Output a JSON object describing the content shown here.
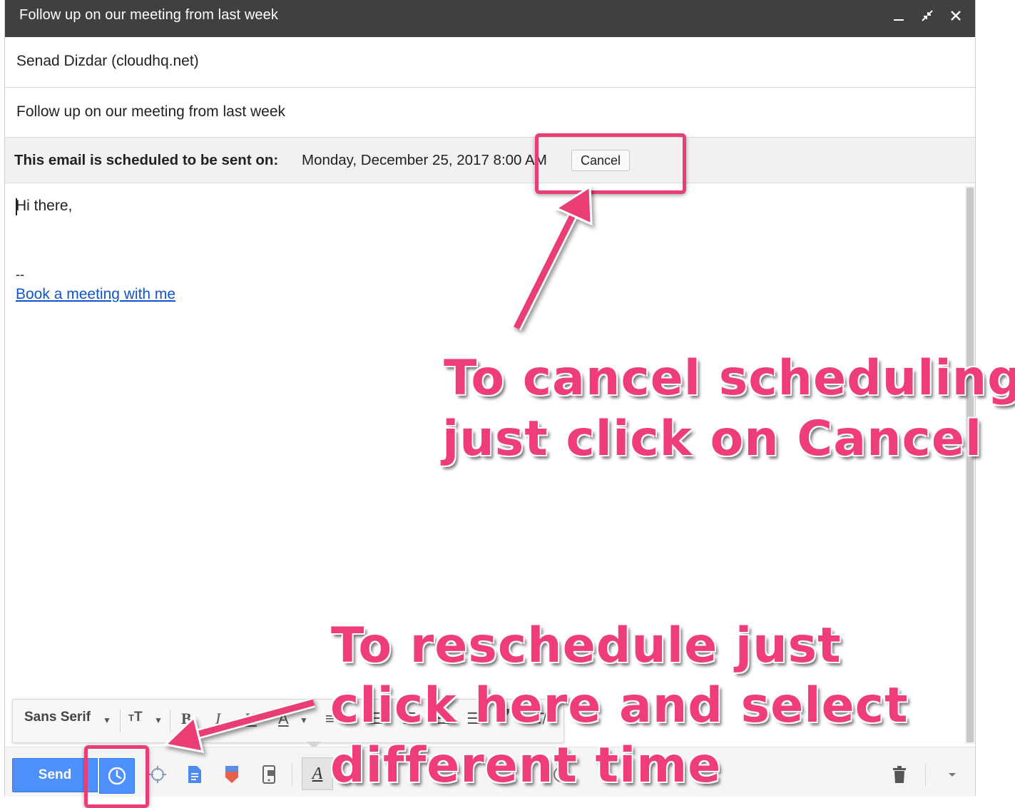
{
  "window": {
    "title": "Follow up on our meeting from last week"
  },
  "compose": {
    "to": "Senad Dizdar (cloudhq.net)",
    "subject": "Follow up on our meeting from last week",
    "schedule": {
      "label": "This email is scheduled to be sent on:",
      "datetime": "Monday, December 25, 2017 8:00 AM",
      "cancel_label": "Cancel"
    },
    "body": {
      "greeting": "Hi there,",
      "signature_dash": "--",
      "link_text": "Book a meeting with me"
    }
  },
  "format_toolbar": {
    "font": "Sans Serif",
    "icons": [
      "font-dropdown-arrow",
      "text-size-icon",
      "bold-icon",
      "italic-icon",
      "underline-icon",
      "text-color-icon",
      "align-icon",
      "numbered-list-icon",
      "bulleted-list-icon",
      "indent-less-icon",
      "indent-more-icon",
      "quote-icon",
      "remove-formatting-icon"
    ]
  },
  "bottom_bar": {
    "send_label": "Send",
    "icons": [
      "schedule-clock-icon",
      "location-icon",
      "docs-icon",
      "label-icon",
      "mobile-icon",
      "formatting-icon",
      "emoji-icon",
      "trash-icon",
      "more-options-icon"
    ]
  },
  "annotations": {
    "cancel_note_line1": "To cancel scheduling",
    "cancel_note_line2": "just click on Cancel",
    "reschedule_note_line1": "To reschedule just",
    "reschedule_note_line2": "click here and select",
    "reschedule_note_line3": "different time"
  },
  "colors": {
    "accent": "#4d90fe",
    "annotation": "#ef3e77",
    "titlebar": "#404040",
    "link": "#1155cc"
  }
}
